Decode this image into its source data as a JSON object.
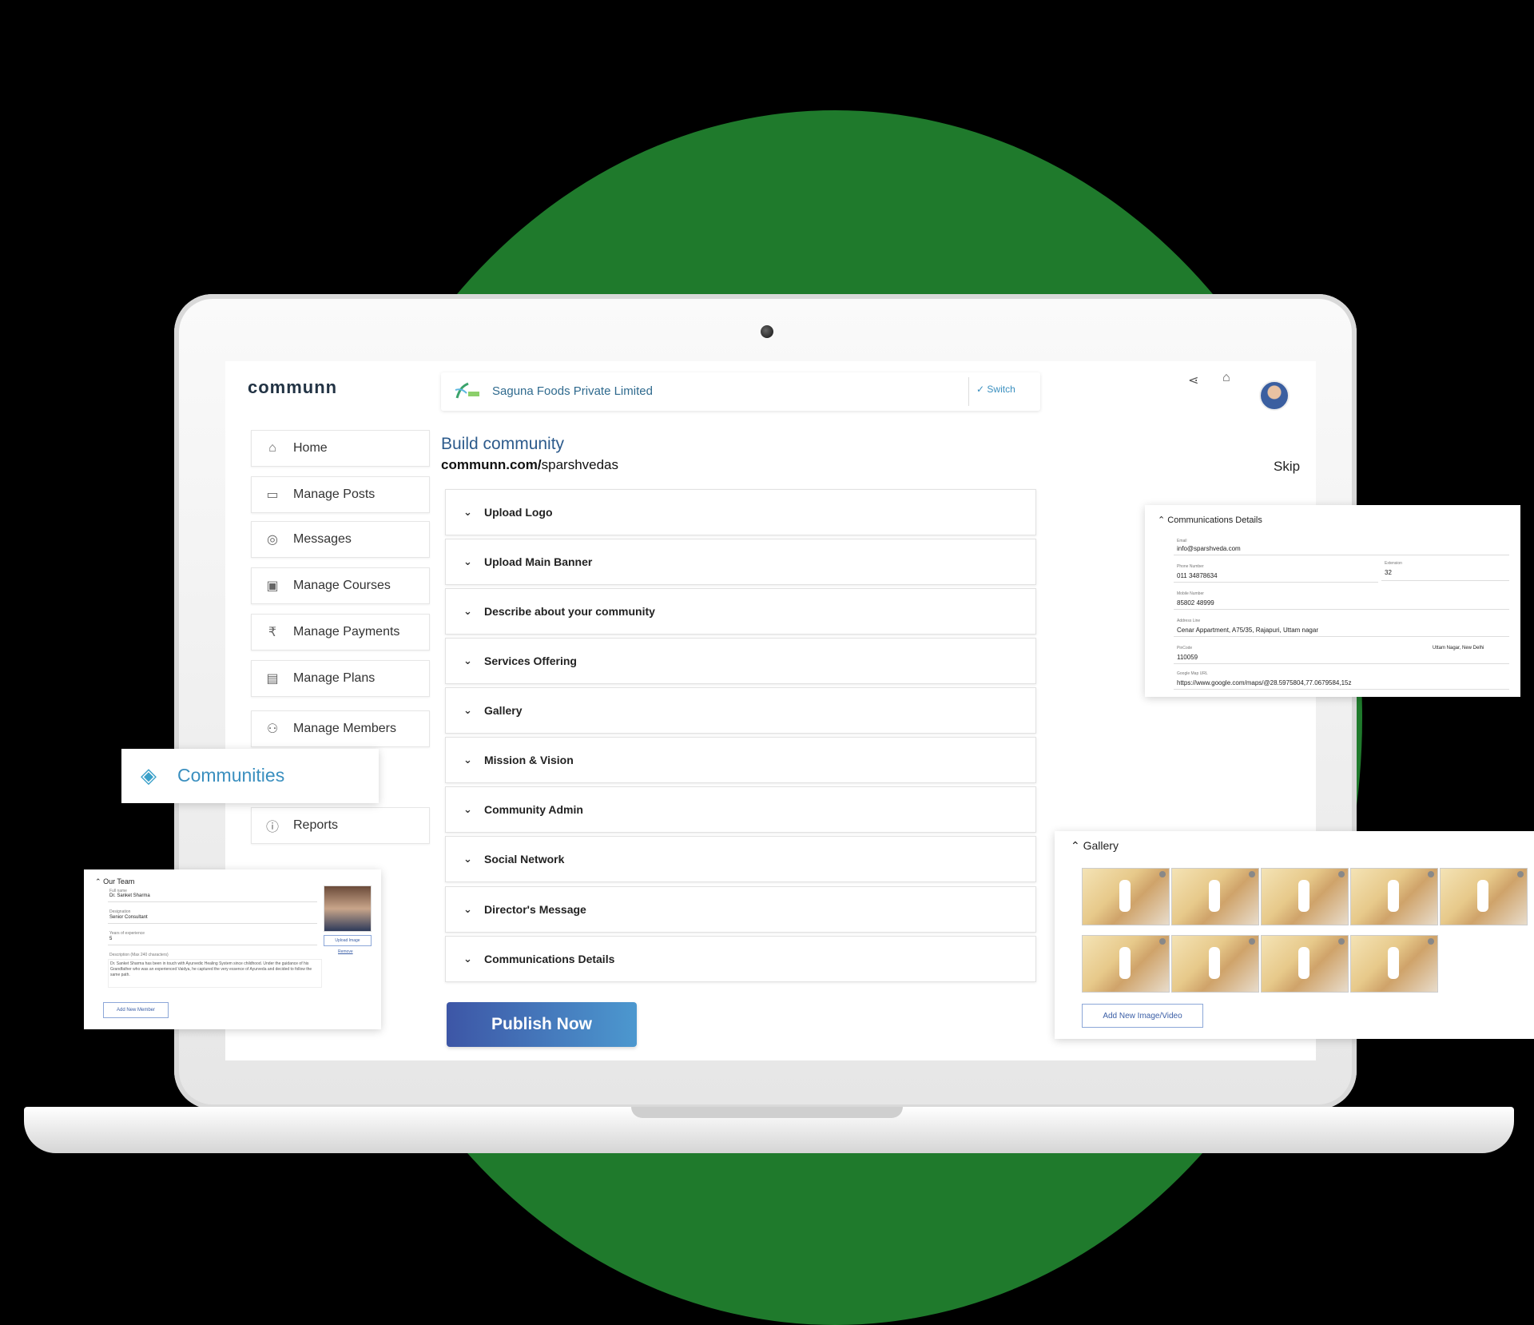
{
  "app": {
    "logo_text": "communn"
  },
  "header": {
    "org_name": "Saguna Foods Private Limited",
    "switch_label": "Switch",
    "share_icon": "share-icon",
    "notification_icon": "bell-icon"
  },
  "sidebar": {
    "items": [
      {
        "label": "Home",
        "icon": "home-icon"
      },
      {
        "label": "Manage Posts",
        "icon": "posts-icon"
      },
      {
        "label": "Messages",
        "icon": "messages-icon"
      },
      {
        "label": "Manage Courses",
        "icon": "courses-icon"
      },
      {
        "label": "Manage Payments",
        "icon": "rupee-icon"
      },
      {
        "label": "Manage Plans",
        "icon": "plans-icon"
      },
      {
        "label": "Manage Members",
        "icon": "members-icon"
      },
      {
        "label": "Communities",
        "icon": "communities-icon"
      },
      {
        "label": "Reports",
        "icon": "reports-icon"
      }
    ]
  },
  "main": {
    "title": "Build community",
    "url_prefix": "communn.com/",
    "url_slug": "sparshvedas",
    "skip_label": "Skip",
    "sections": [
      "Upload Logo",
      "Upload Main Banner",
      "Describe about your community",
      "Services Offering",
      "Gallery",
      "Mission & Vision",
      "Community Admin",
      "Social Network",
      "Director's Message",
      "Communications Details"
    ],
    "publish_label": "Publish Now"
  },
  "team_card": {
    "title": "Our Team",
    "full_name_label": "Full name",
    "full_name": "Dr. Sanket Sharma",
    "designation_label": "Designation",
    "designation": "Senior Consultant",
    "experience_label": "Years of experience",
    "experience": "5",
    "description_label": "Description (Max 240 characters)",
    "description": "Dr. Sanket Sharma has been in touch with Ayurvedic Healing System since childhood. Under the guidance of his Grandfather who was an experienced Vaidya, he captured the very essence of Ayurveda and decided to follow the same path.",
    "upload_label": "Upload Image",
    "remove_label": "Remove",
    "add_member_label": "Add New Member"
  },
  "comm_card": {
    "title": "Communications Details",
    "email_label": "Email",
    "email": "info@sparshveda.com",
    "phone_label": "Phone Number",
    "phone": "011 34878634",
    "extension_label": "Extension",
    "extension": "32",
    "mobile_label": "Mobile Number",
    "mobile": "85802 48999",
    "address_label": "Address Line",
    "address": "Cenar Appartment, A75/35, Rajapuri, Uttam nagar",
    "pincode_label": "PinCode",
    "pincode": "110059",
    "city": "Uttam Nagar, New Delhi",
    "map_label": "Google Map URL",
    "map_url": "https://www.google.com/maps/@28.5975804,77.0679584,15z"
  },
  "gallery_card": {
    "title": "Gallery",
    "add_label": "Add New Image/Video"
  },
  "colors": {
    "accent": "#2d5b8c",
    "link": "#3a8fbf",
    "publish_start": "#3d56a6",
    "publish_end": "#4c98cf",
    "backdrop_green": "#1f7a2c"
  }
}
